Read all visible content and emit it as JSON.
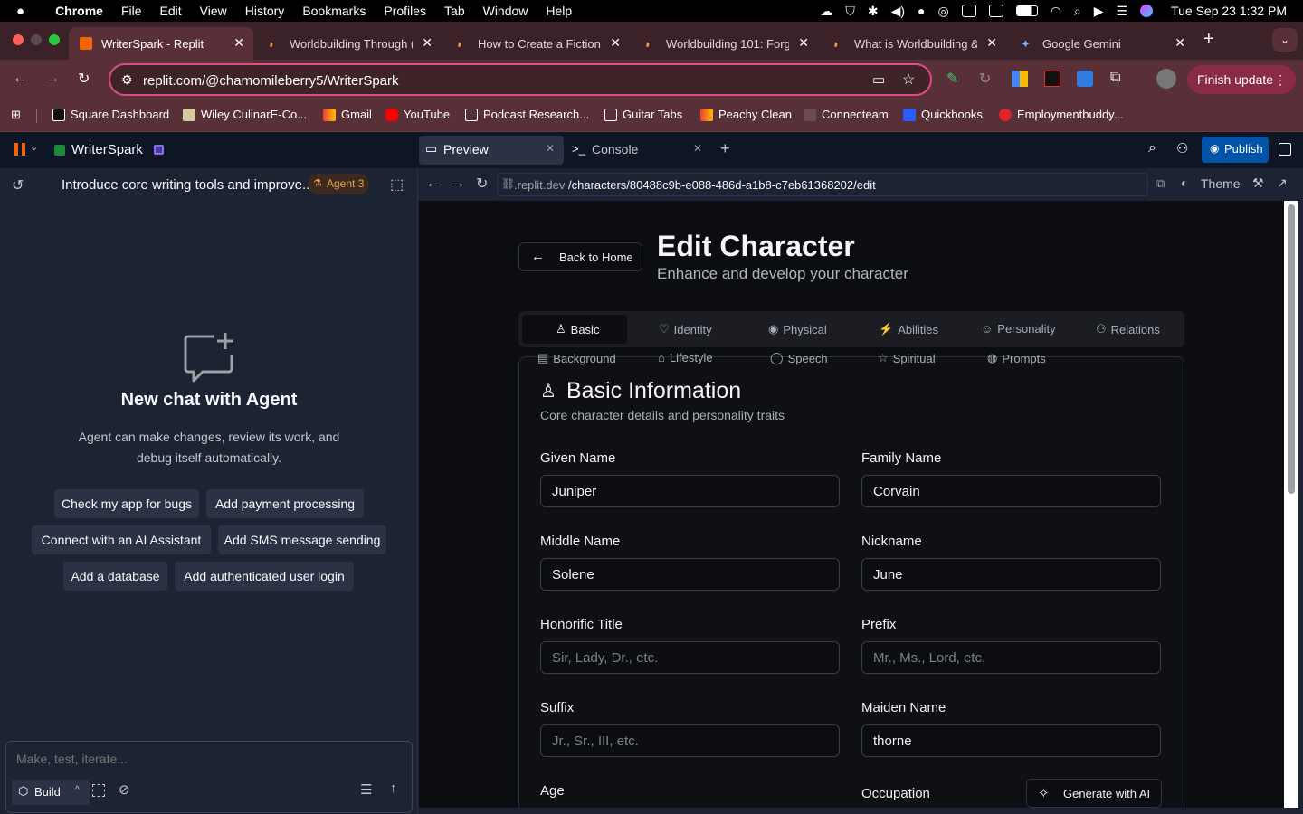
{
  "menubar": {
    "app": "Chrome",
    "items": [
      "File",
      "Edit",
      "View",
      "History",
      "Bookmarks",
      "Profiles",
      "Tab",
      "Window",
      "Help"
    ],
    "datetime": "Tue Sep 23  1:32 PM"
  },
  "tabs": [
    {
      "title": "WriterSpark - Replit",
      "active": true
    },
    {
      "title": "Worldbuilding Through (",
      "active": false
    },
    {
      "title": "How to Create a Fictiona",
      "active": false
    },
    {
      "title": "Worldbuilding 101: Forg",
      "active": false
    },
    {
      "title": "What is Worldbuilding &",
      "active": false
    },
    {
      "title": "Google Gemini",
      "active": false
    }
  ],
  "address": {
    "url": "replit.com/@chamomileberry5/WriterSpark"
  },
  "finish_update": "Finish update",
  "bookmarks": [
    "Square Dashboard",
    "Wiley CulinarE-Co...",
    "Gmail",
    "YouTube",
    "Podcast Research...",
    "Guitar Tabs",
    "Peachy Clean",
    "Connecteam",
    "Quickbooks",
    "Employmentbuddy..."
  ],
  "replit": {
    "app_name": "WriterSpark",
    "tab_preview": "Preview",
    "tab_console": "Console",
    "publish": "Publish"
  },
  "agent": {
    "thread_title": "Introduce core writing tools and improve...",
    "badge": "Agent 3",
    "new_chat_title": "New chat with Agent",
    "new_chat_desc_1": "Agent can make changes, review its work, and",
    "new_chat_desc_2": "debug itself automatically.",
    "suggestions": [
      "Check my app for bugs",
      "Add payment processing",
      "Connect with an AI Assistant",
      "Add SMS message sending",
      "Add a database",
      "Add authenticated user login"
    ],
    "input_placeholder": "Make, test, iterate...",
    "build_label": "Build"
  },
  "preview_bar": {
    "url_host": ".replit.dev",
    "url_path": "/characters/80488c9b-e088-486d-a1b8-c7eb61368202/edit",
    "theme": "Theme"
  },
  "page": {
    "back": "Back to Home",
    "title": "Edit Character",
    "subtitle": "Enhance and develop your character",
    "tabs_row1": [
      "Basic",
      "Identity",
      "Physical",
      "Abilities",
      "Personality",
      "Relations"
    ],
    "tabs_row2": [
      "Background",
      "Lifestyle",
      "Speech",
      "Spiritual",
      "Prompts"
    ],
    "section_title": "Basic Information",
    "section_desc": "Core character details and personality traits",
    "fields": {
      "given_name": {
        "label": "Given Name",
        "value": "Juniper"
      },
      "family_name": {
        "label": "Family Name",
        "value": "Corvain"
      },
      "middle_name": {
        "label": "Middle Name",
        "value": "Solene"
      },
      "nickname": {
        "label": "Nickname",
        "value": "June"
      },
      "honorific": {
        "label": "Honorific Title",
        "placeholder": "Sir, Lady, Dr., etc."
      },
      "prefix": {
        "label": "Prefix",
        "placeholder": "Mr., Ms., Lord, etc."
      },
      "suffix": {
        "label": "Suffix",
        "placeholder": "Jr., Sr., III, etc."
      },
      "maiden_name": {
        "label": "Maiden Name",
        "value": "thorne"
      },
      "age": {
        "label": "Age"
      },
      "occupation": {
        "label": "Occupation"
      }
    },
    "generate_ai": "Generate with AI"
  },
  "colors": {
    "accent_blue": "#0053a6",
    "tab_strip": "#3a2228",
    "agent_badge": "#f2a146"
  }
}
